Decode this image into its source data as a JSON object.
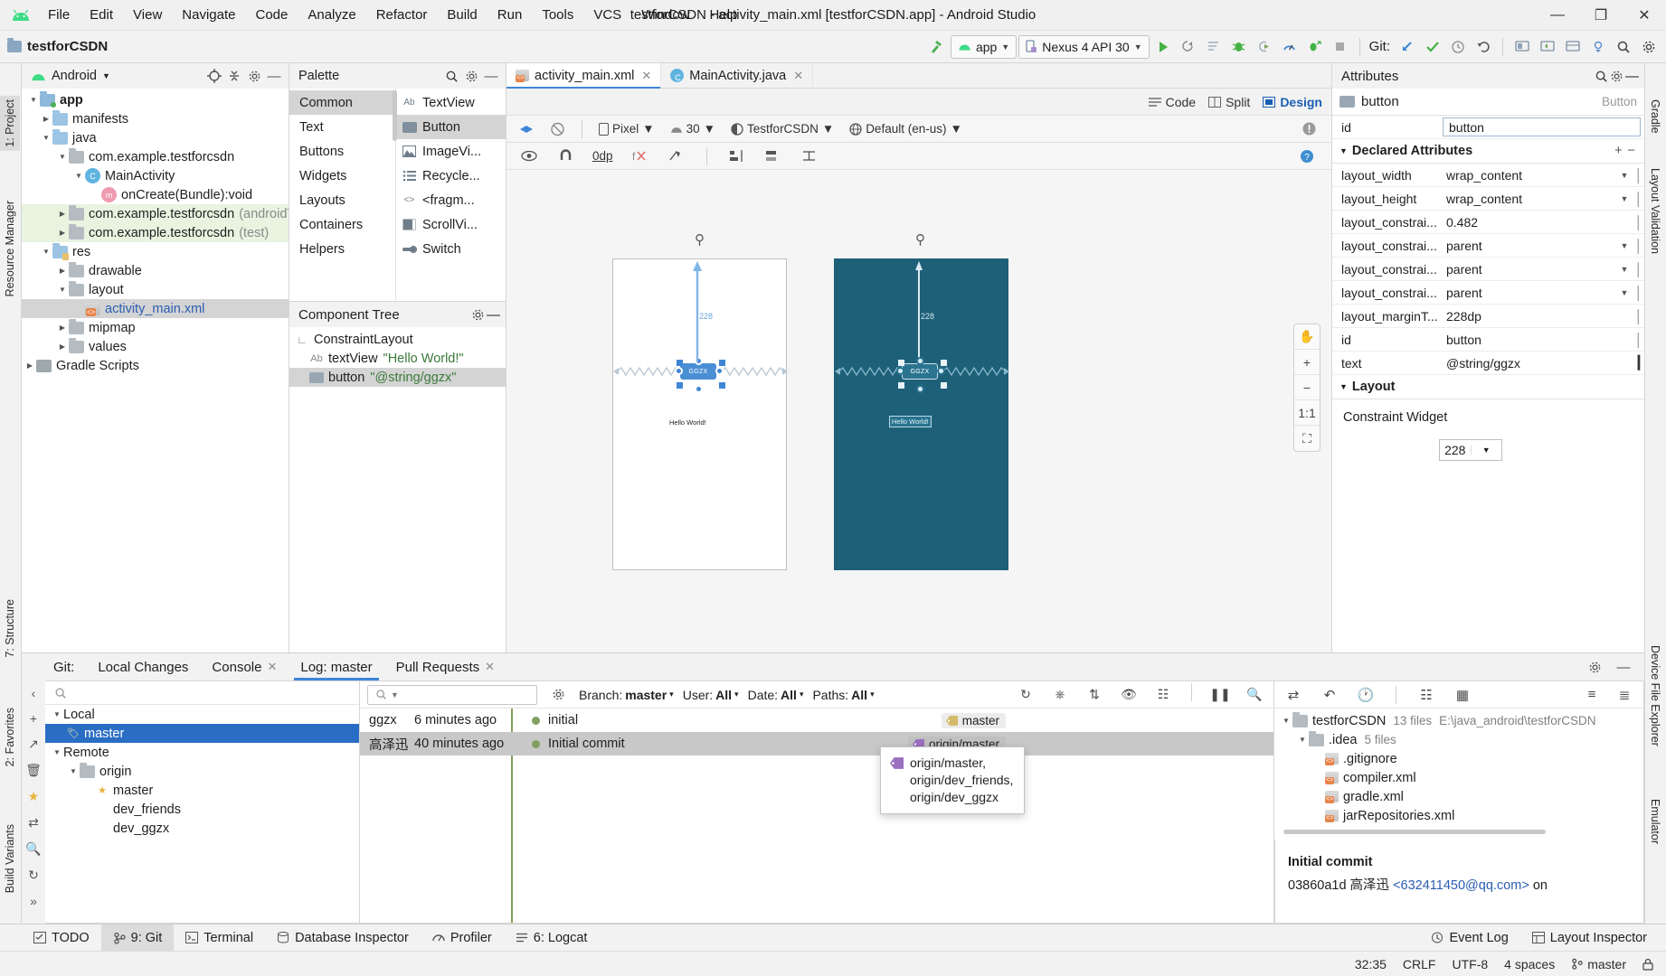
{
  "window": {
    "title": "testforCSDN - activity_main.xml [testforCSDN.app] - Android Studio",
    "minimize": "—",
    "maximize": "❐",
    "close": "✕"
  },
  "menu": [
    "File",
    "Edit",
    "View",
    "Navigate",
    "Code",
    "Analyze",
    "Refactor",
    "Build",
    "Run",
    "Tools",
    "VCS",
    "Window",
    "Help"
  ],
  "navbar": {
    "project_crumb": "testforCSDN",
    "module_selector": "app",
    "device_selector": "Nexus 4 API 30",
    "git_label": "Git:"
  },
  "left_rail": [
    "1: Project",
    "Resource Manager"
  ],
  "left_rail_bottom": [
    "7: Structure",
    "2: Favorites",
    "Build Variants"
  ],
  "right_rail": [
    "Gradle",
    "Layout Validation"
  ],
  "right_rail_bottom": [
    "Device File Explorer",
    "Emulator"
  ],
  "project_panel": {
    "title": "Android",
    "tree": [
      {
        "label": "app",
        "indent": 0,
        "arrow": "▼",
        "icon": "module",
        "bold": true
      },
      {
        "label": "manifests",
        "indent": 1,
        "arrow": "▶",
        "icon": "folder-blue"
      },
      {
        "label": "java",
        "indent": 1,
        "arrow": "▼",
        "icon": "folder-blue"
      },
      {
        "label": "com.example.testforcsdn",
        "indent": 2,
        "arrow": "▼",
        "icon": "folder-gray"
      },
      {
        "label": "MainActivity",
        "indent": 3,
        "arrow": "▼",
        "icon": "class"
      },
      {
        "label": "onCreate(Bundle):void",
        "indent": 4,
        "arrow": "",
        "icon": "method"
      },
      {
        "label": "com.example.testforcsdn",
        "suffix": "(androidT",
        "indent": 2,
        "arrow": "▶",
        "icon": "folder-gray",
        "highlight": "green"
      },
      {
        "label": "com.example.testforcsdn",
        "suffix": "(test)",
        "indent": 2,
        "arrow": "▶",
        "icon": "folder-gray",
        "highlight": "green"
      },
      {
        "label": "res",
        "indent": 1,
        "arrow": "▼",
        "icon": "folder-res"
      },
      {
        "label": "drawable",
        "indent": 2,
        "arrow": "▶",
        "icon": "folder-gray"
      },
      {
        "label": "layout",
        "indent": 2,
        "arrow": "▼",
        "icon": "folder-gray"
      },
      {
        "label": "activity_main.xml",
        "indent": 3,
        "arrow": "",
        "icon": "xml",
        "selected": true,
        "link": true
      },
      {
        "label": "mipmap",
        "indent": 2,
        "arrow": "▶",
        "icon": "folder-gray"
      },
      {
        "label": "values",
        "indent": 2,
        "arrow": "▶",
        "icon": "folder-gray"
      },
      {
        "label": "Gradle Scripts",
        "indent": 0,
        "arrow": "▶",
        "icon": "gradle"
      }
    ]
  },
  "palette": {
    "title": "Palette",
    "categories": [
      "Common",
      "Text",
      "Buttons",
      "Widgets",
      "Layouts",
      "Containers",
      "Helpers"
    ],
    "selected_category": "Common",
    "items": [
      {
        "label": "TextView",
        "icon": "Ab"
      },
      {
        "label": "Button",
        "icon": "button-box",
        "selected": true
      },
      {
        "label": "ImageVi...",
        "icon": "image"
      },
      {
        "label": "Recycle...",
        "icon": "list"
      },
      {
        "label": "<fragm...",
        "icon": "code"
      },
      {
        "label": "ScrollVi...",
        "icon": "scroll"
      },
      {
        "label": "Switch",
        "icon": "switch"
      }
    ]
  },
  "component_tree": {
    "title": "Component Tree",
    "rows": [
      {
        "label": "ConstraintLayout",
        "indent": 0,
        "icon": "constraint",
        "value": ""
      },
      {
        "label": "textView",
        "indent": 1,
        "icon": "ab",
        "value": "\"Hello World!\""
      },
      {
        "label": "button",
        "indent": 1,
        "icon": "button",
        "value": "\"@string/ggzx\"",
        "selected": true
      }
    ]
  },
  "editor": {
    "tabs": [
      {
        "label": "activity_main.xml",
        "icon": "xml",
        "active": true,
        "close": "✕"
      },
      {
        "label": "MainActivity.java",
        "icon": "java",
        "active": false,
        "close": "✕"
      }
    ],
    "modes": [
      {
        "label": "Code",
        "selected": false
      },
      {
        "label": "Split",
        "selected": false
      },
      {
        "label": "Design",
        "selected": true
      }
    ],
    "toolbar": {
      "device": "Pixel",
      "api": "30",
      "theme": "TestforCSDN",
      "locale": "Default (en-us)",
      "margin_value": "0dp"
    },
    "canvas": {
      "dim_label_light": "228",
      "dim_label_dark": "228",
      "hello_text": "Hello World!",
      "button_text": "GGZX",
      "zoom_buttons": [
        "✋",
        "+",
        "−",
        "1:1",
        "⛶"
      ]
    }
  },
  "attributes": {
    "title": "Attributes",
    "component_name": "button",
    "component_type": "Button",
    "id_key": "id",
    "id_value": "button",
    "declared_section": "Declared Attributes",
    "declared_add": "+",
    "declared_remove": "−",
    "rows": [
      {
        "key": "layout_width",
        "value": "wrap_content",
        "dropdown": true
      },
      {
        "key": "layout_height",
        "value": "wrap_content",
        "dropdown": true
      },
      {
        "key": "layout_constrai...",
        "value": "0.482",
        "dropdown": false
      },
      {
        "key": "layout_constrai...",
        "value": "parent",
        "dropdown": true
      },
      {
        "key": "layout_constrai...",
        "value": "parent",
        "dropdown": true
      },
      {
        "key": "layout_constrai...",
        "value": "parent",
        "dropdown": true
      },
      {
        "key": "layout_marginT...",
        "value": "228dp",
        "dropdown": false
      },
      {
        "key": "id",
        "value": "button",
        "dropdown": false
      },
      {
        "key": "text",
        "value": "@string/ggzx",
        "dropdown": false
      }
    ],
    "layout_section": "Layout",
    "constraint_widget": "Constraint Widget",
    "constraint_value": "228"
  },
  "git": {
    "tabs": [
      {
        "label": "Git:",
        "type": "title"
      },
      {
        "label": "Local Changes",
        "active": false
      },
      {
        "label": "Console",
        "active": false,
        "close": "✕"
      },
      {
        "label": "Log: master",
        "active": true
      },
      {
        "label": "Pull Requests",
        "active": false,
        "close": "✕"
      }
    ],
    "branches": {
      "search_placeholder": "",
      "rows": [
        {
          "label": "Local",
          "indent": 0,
          "arrow": "▼",
          "icon": "none"
        },
        {
          "label": "master",
          "indent": 1,
          "arrow": "",
          "icon": "tag",
          "selected": true
        },
        {
          "label": "Remote",
          "indent": 0,
          "arrow": "▼",
          "icon": "none"
        },
        {
          "label": "origin",
          "indent": 1,
          "arrow": "▼",
          "icon": "folder"
        },
        {
          "label": "master",
          "indent": 2,
          "arrow": "",
          "icon": "star"
        },
        {
          "label": "dev_friends",
          "indent": 2,
          "arrow": "",
          "icon": "none"
        },
        {
          "label": "dev_ggzx",
          "indent": 2,
          "arrow": "",
          "icon": "none"
        }
      ]
    },
    "filters": {
      "search_placeholder": "",
      "branch": {
        "label": "Branch:",
        "value": "master"
      },
      "user": {
        "label": "User:",
        "value": "All"
      },
      "date": {
        "label": "Date:",
        "value": "All"
      },
      "paths": {
        "label": "Paths:",
        "value": "All"
      }
    },
    "commits": [
      {
        "author": "ggzx",
        "date": "6 minutes ago",
        "message": "initial",
        "badge": "master",
        "selected": false
      },
      {
        "author": "高泽迅",
        "date": "40 minutes ago",
        "message": "Initial commit",
        "badge": "origin/master",
        "selected": true
      }
    ],
    "tooltip": [
      "origin/master,",
      "origin/dev_friends,",
      "origin/dev_ggzx"
    ],
    "files": {
      "root": "testforCSDN",
      "root_meta": "13 files",
      "root_path": "E:\\java_android\\testforCSDN",
      "rows": [
        {
          "label": ".idea",
          "indent": 1,
          "arrow": "▼",
          "meta": "5 files",
          "icon": "folder"
        },
        {
          "label": ".gitignore",
          "indent": 2,
          "arrow": "",
          "meta": "",
          "icon": "file"
        },
        {
          "label": "compiler.xml",
          "indent": 2,
          "arrow": "",
          "meta": "",
          "icon": "file"
        },
        {
          "label": "gradle.xml",
          "indent": 2,
          "arrow": "",
          "meta": "",
          "icon": "file"
        },
        {
          "label": "jarRepositories.xml",
          "indent": 2,
          "arrow": "",
          "meta": "",
          "icon": "file"
        }
      ]
    },
    "detail": {
      "title": "Initial commit",
      "hash": "03860a1d",
      "author": "高泽迅",
      "email": "<632411450@qq.com>",
      "on": "on"
    }
  },
  "toolwindows": [
    {
      "label": "TODO",
      "icon": "checklist",
      "selected": false
    },
    {
      "label": "9: Git",
      "icon": "git",
      "selected": true
    },
    {
      "label": "Terminal",
      "icon": "terminal",
      "selected": false
    },
    {
      "label": "Database Inspector",
      "icon": "db",
      "selected": false
    },
    {
      "label": "Profiler",
      "icon": "profiler",
      "selected": false
    },
    {
      "label": "6: Logcat",
      "icon": "logcat",
      "selected": false
    }
  ],
  "toolwindows_right": [
    {
      "label": "Event Log",
      "icon": "event"
    },
    {
      "label": "Layout Inspector",
      "icon": "layout"
    }
  ],
  "status_bar": {
    "caret": "32:35",
    "line_ending": "CRLF",
    "encoding": "UTF-8",
    "indent": "4 spaces",
    "branch": "master",
    "lock": "🔒"
  },
  "colors": {
    "accent_blue": "#3f86d6",
    "dark_preview": "#1f6079",
    "selection": "#2a6dc4",
    "green": "#4caf50"
  }
}
